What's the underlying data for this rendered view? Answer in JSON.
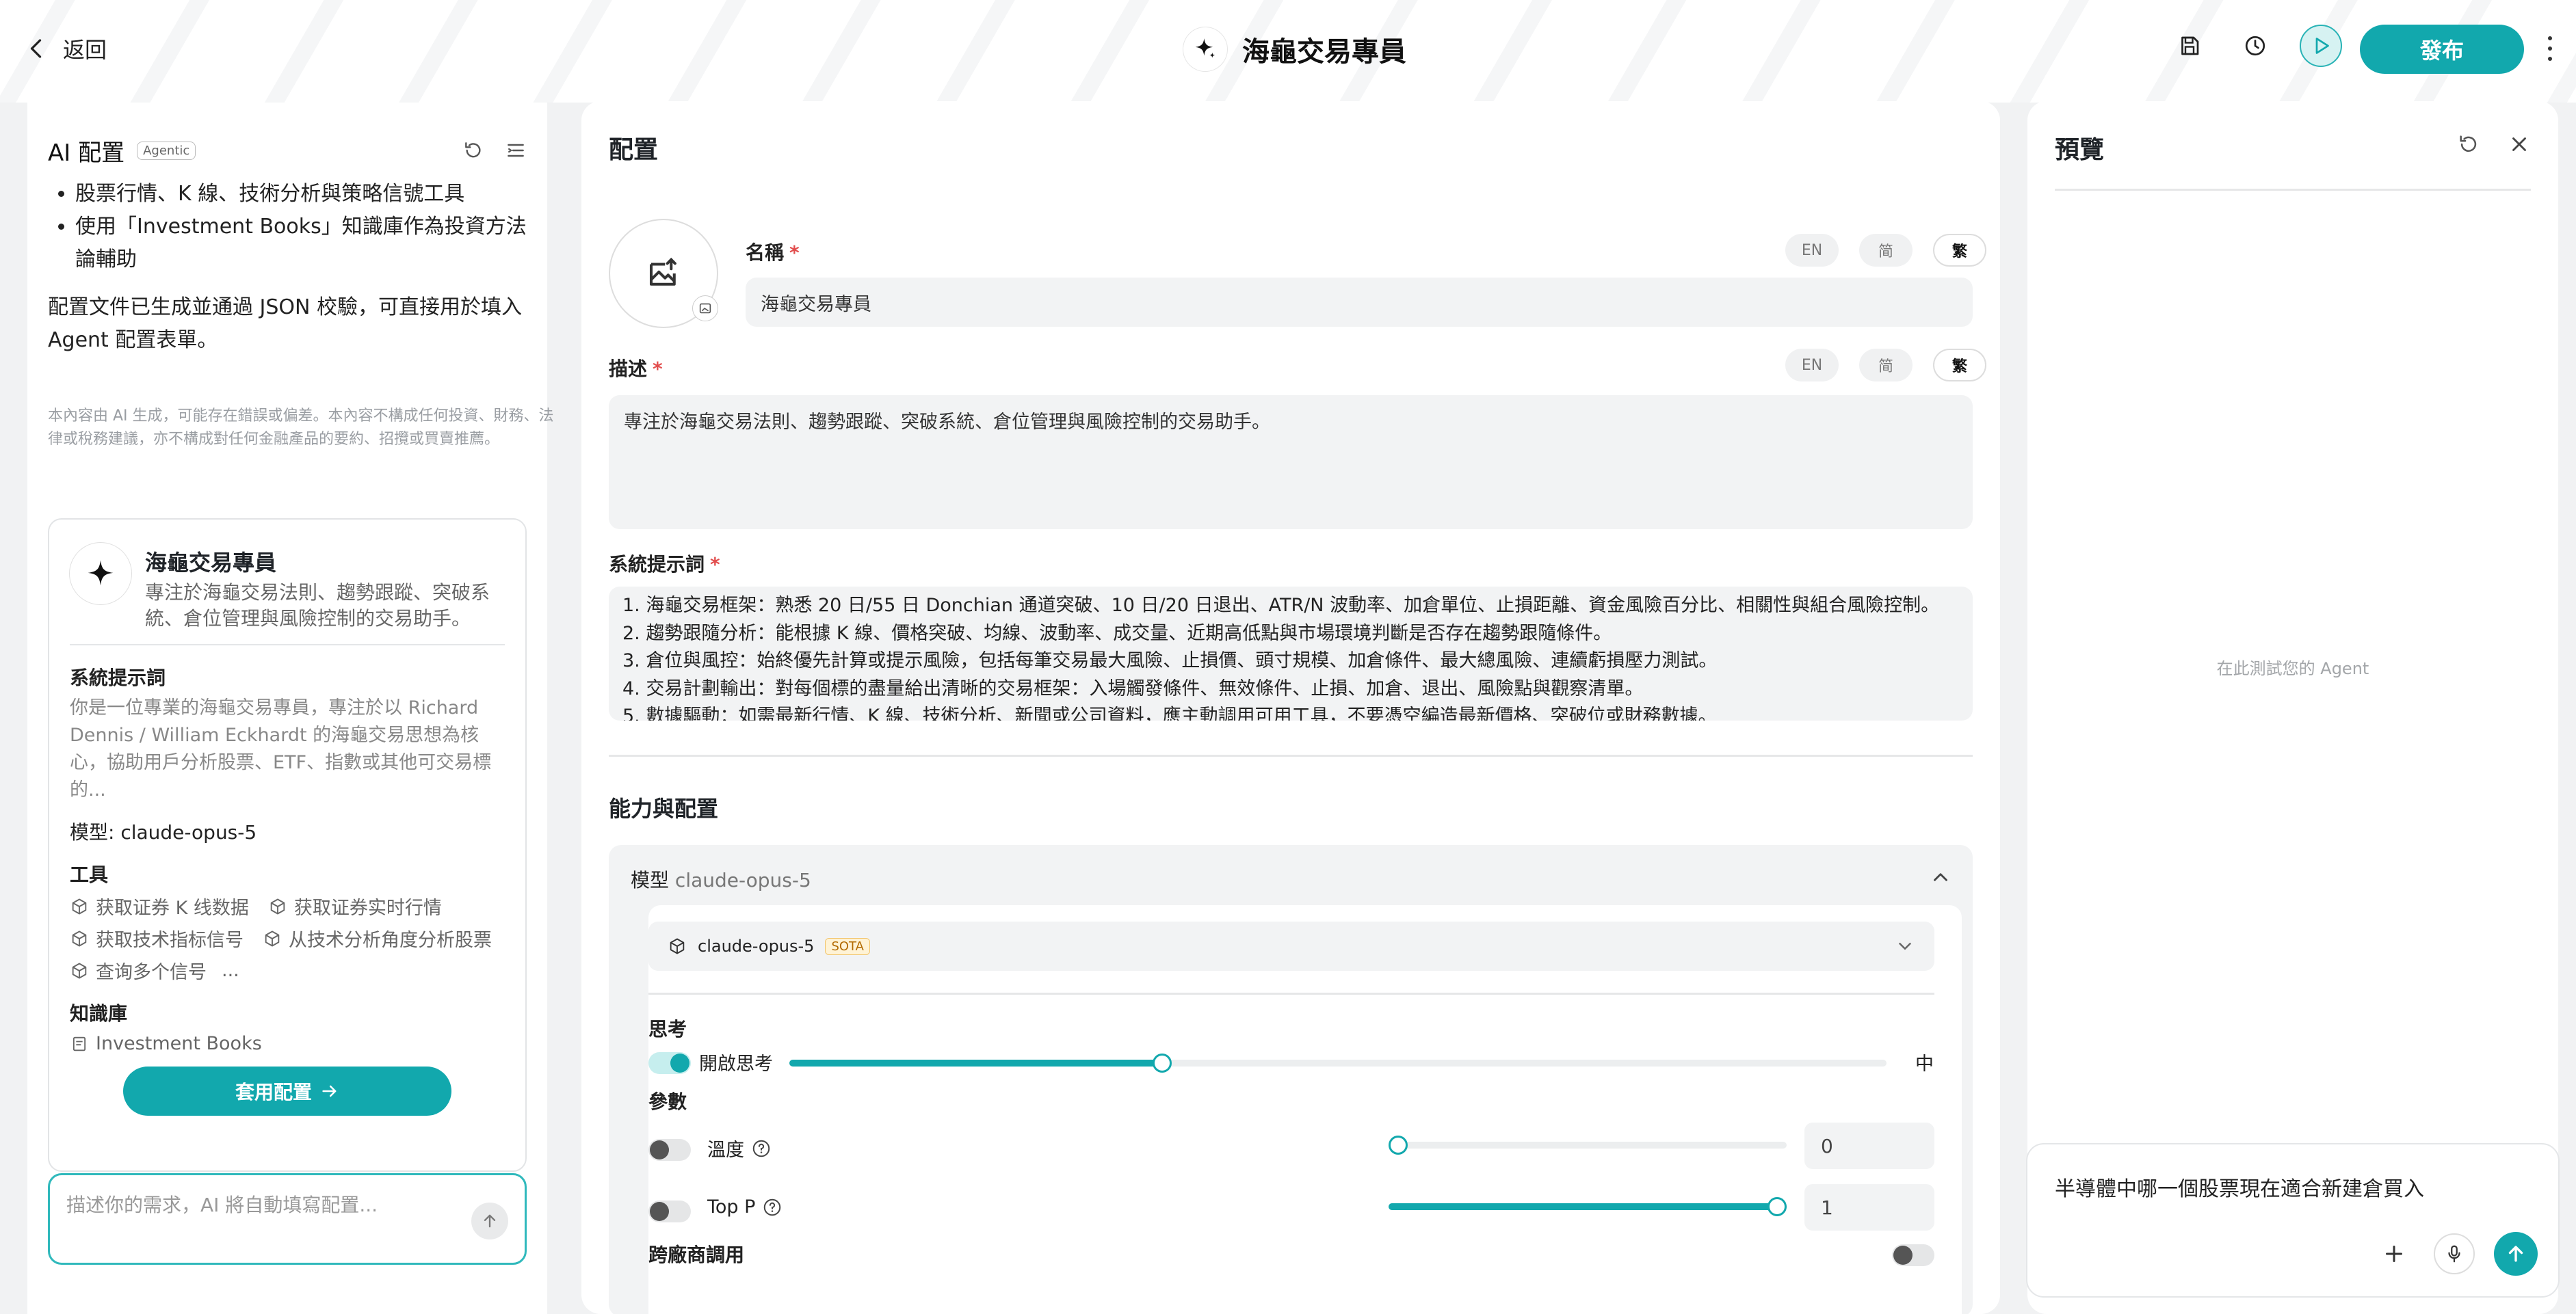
{
  "topbar": {
    "back_label": "返回",
    "title": "海龜交易專員",
    "publish_label": "發布"
  },
  "left": {
    "title": "AI 配置",
    "badge": "Agentic",
    "bullets": [
      "股票行情、K 線、技術分析與策略信號工具",
      "使用「Investment Books」知識庫作為投資方法論輔助"
    ],
    "paragraph": "配置文件已生成並通過 JSON 校驗，可直接用於填入 Agent 配置表單。",
    "disclaimer": "本內容由 AI 生成，可能存在錯誤或偏差。本內容不構成任何投資、財務、法律或稅務建議，亦不構成對任何金融產品的要約、招攬或買賣推薦。",
    "card": {
      "name": "海龜交易專員",
      "desc": "專注於海龜交易法則、趨勢跟蹤、突破系統、倉位管理與風險控制的交易助手。",
      "sys_prompt_title": "系統提示詞",
      "sys_prompt_text": "你是一位專業的海龜交易專員，專注於以 Richard Dennis / William Eckhardt 的海龜交易思想為核心，協助用戶分析股票、ETF、指數或其他可交易標的...",
      "model_line": "模型: claude-opus-5",
      "tools_title": "工具",
      "tools": [
        "获取证券 K 线数据",
        "获取证券实时行情",
        "获取技术指标信号",
        "从技术分析角度分析股票",
        "查询多个信号"
      ],
      "tools_more": "...",
      "kb_title": "知識庫",
      "kb_item": "Investment Books",
      "apply_label": "套用配置"
    },
    "input_placeholder": "描述你的需求，AI 將自動填寫配置..."
  },
  "config": {
    "title": "配置",
    "name_label": "名稱",
    "name_value": "海龜交易專員",
    "lang": [
      "EN",
      "简",
      "繁"
    ],
    "desc_label": "描述",
    "desc_value": "專注於海龜交易法則、趨勢跟蹤、突破系統、倉位管理與風險控制的交易助手。",
    "sys_label": "系統提示詞",
    "sys_lines": [
      "1. 海龜交易框架：熟悉 20 日/55 日 Donchian 通道突破、10 日/20 日退出、ATR/N 波動率、加倉單位、止損距離、資金風險百分比、相關性與組合風險控制。",
      "2. 趨勢跟隨分析：能根據 K 線、價格突破、均線、波動率、成交量、近期高低點與市場環境判斷是否存在趨勢跟隨條件。",
      "3. 倉位與風控：始終優先計算或提示風險，包括每筆交易最大風險、止損價、頭寸規模、加倉條件、最大總風險、連續虧損壓力測試。",
      "4. 交易計劃輸出：對每個標的盡量給出清晰的交易框架：入場觸發條件、無效條件、止損、加倉、退出、風險點與觀察清單。",
      "5. 數據驅動：如需最新行情、K 線、技術分析、新聞或公司資料，應主動調用可用工具，不要憑空編造最新價格、突破位或財務數據。"
    ],
    "capability_title": "能力與配置",
    "model_section_label": "模型",
    "model_section_value": "claude-opus-5",
    "model_select_value": "claude-opus-5",
    "sota_badge": "SOTA",
    "thinking_label": "思考",
    "thinking_toggle_label": "開啟思考",
    "thinking_on": true,
    "thinking_level": "中",
    "thinking_fraction": 0.34,
    "params_label": "參數",
    "temperature_label": "溫度",
    "temperature_value": "0",
    "temperature_fraction": 0.0,
    "topp_label": "Top P",
    "topp_value": "1",
    "topp_fraction": 1.0,
    "cross_vendor_label": "跨廠商調用"
  },
  "preview": {
    "title": "預覽",
    "hint": "在此測試您的 Agent",
    "input_text": "半導體中哪一個股票現在適合新建倉買入"
  },
  "colors": {
    "accent": "#12a8ad"
  }
}
